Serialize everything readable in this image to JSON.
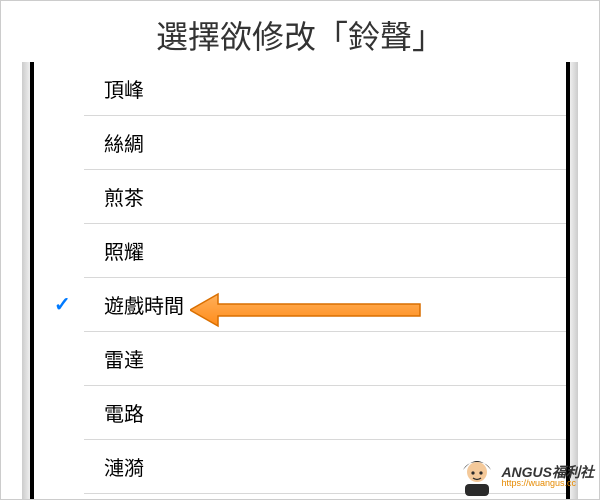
{
  "title": "選擇欲修改「鈴聲」",
  "ringtones": [
    {
      "label": "頂峰",
      "selected": false
    },
    {
      "label": "絲綢",
      "selected": false
    },
    {
      "label": "煎茶",
      "selected": false
    },
    {
      "label": "照耀",
      "selected": false
    },
    {
      "label": "遊戲時間",
      "selected": true
    },
    {
      "label": "雷達",
      "selected": false
    },
    {
      "label": "電路",
      "selected": false
    },
    {
      "label": "漣漪",
      "selected": false
    }
  ],
  "watermark": {
    "brand_part1": "ANGUS",
    "brand_part2": "福利社",
    "url": "https://wuangus.cc"
  }
}
